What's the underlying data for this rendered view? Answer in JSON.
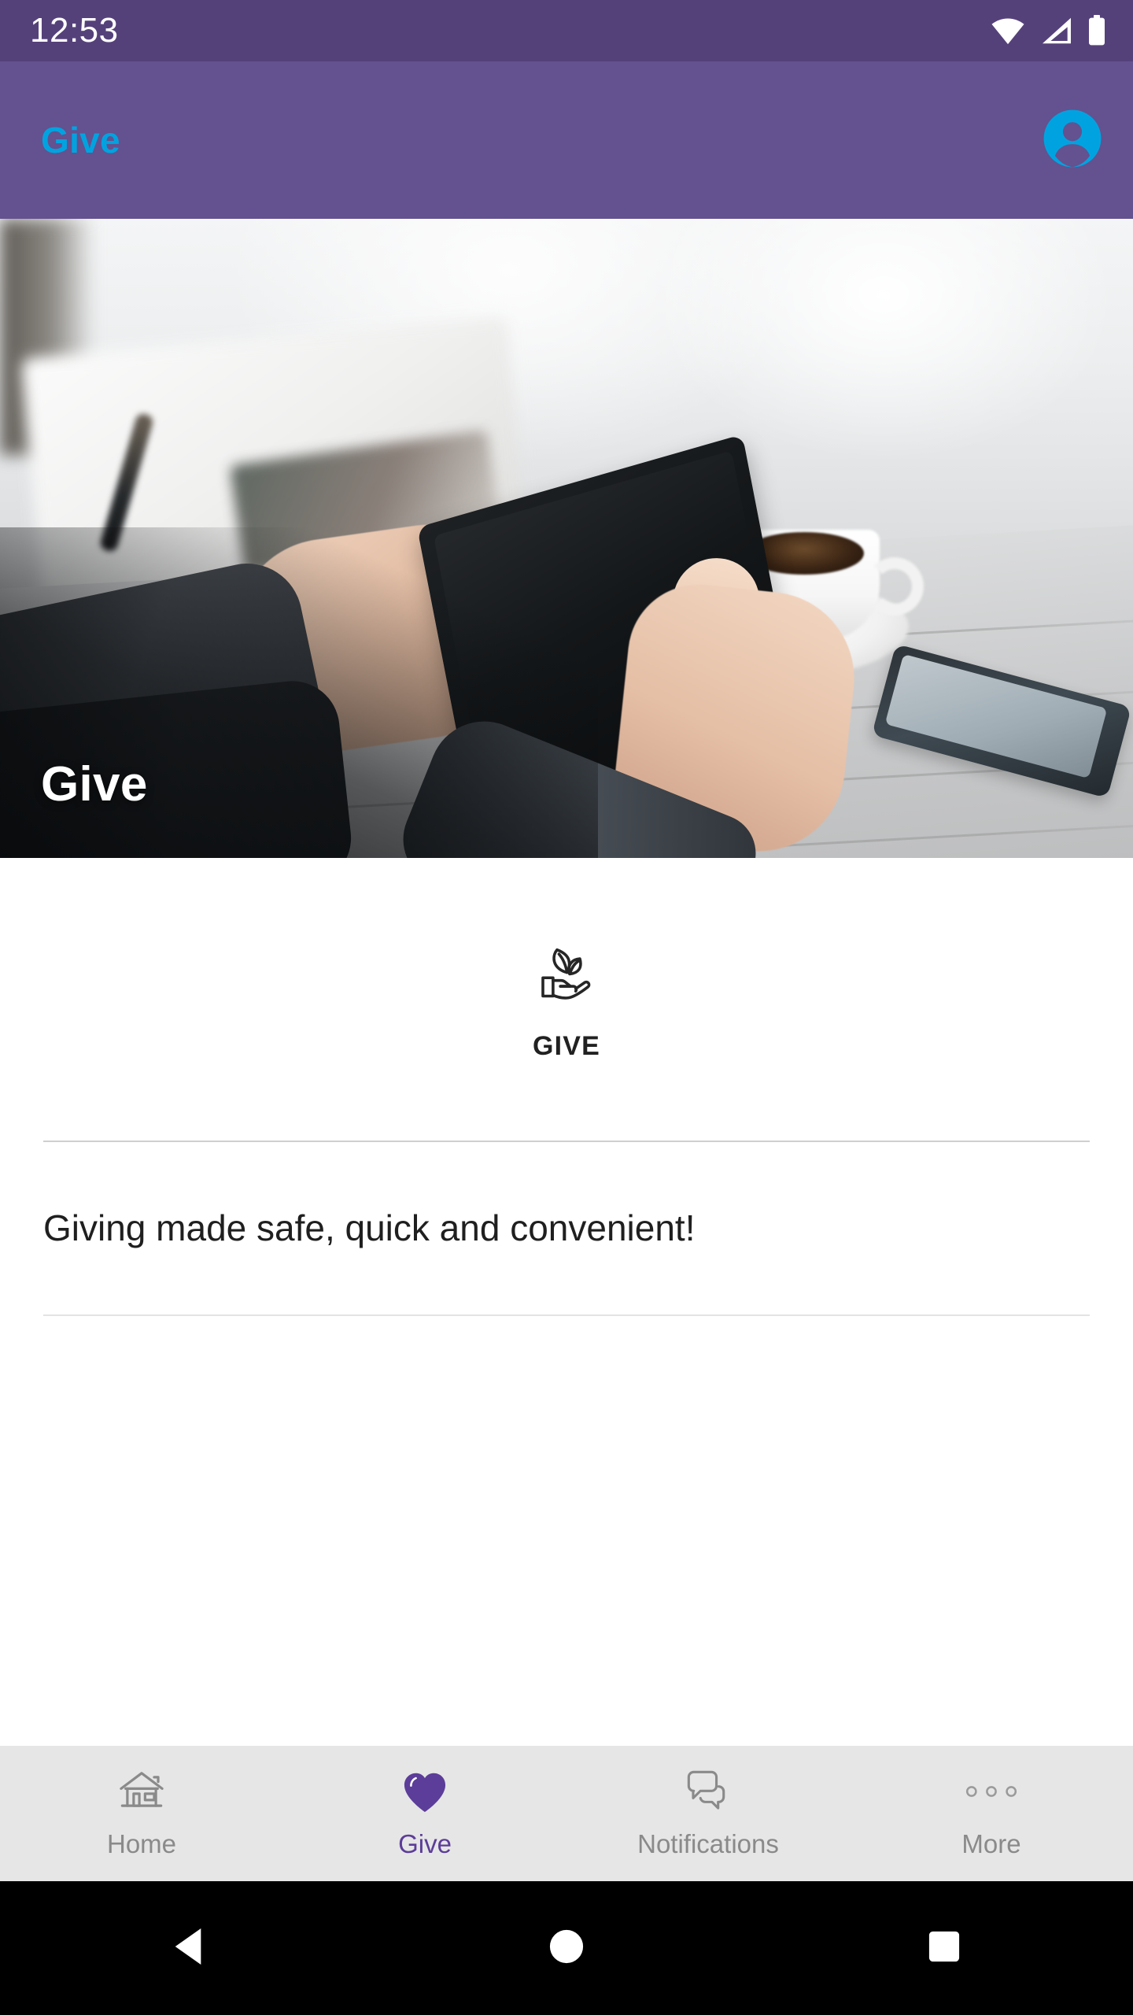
{
  "status_bar": {
    "time": "12:53",
    "icons": [
      "wifi-icon",
      "cellular-signal-icon",
      "battery-icon"
    ],
    "background_color": "#55417a",
    "foreground_color": "#ffffff"
  },
  "app_bar": {
    "title": "Give",
    "title_color": "#00a3e0",
    "background_color": "#64518f",
    "account_icon": "account-avatar-icon"
  },
  "hero": {
    "title": "Give",
    "image_description": "Person holding a black tablet at a light wooden table with a white cup of coffee and a smartphone"
  },
  "content": {
    "tile": {
      "icon": "hand-holding-plant-icon",
      "label": "GIVE"
    },
    "tagline": "Giving made safe, quick and convenient!"
  },
  "bottom_nav": {
    "active_color": "#5c3d99",
    "inactive_color": "#8a8a8a",
    "background_color": "#e6e6e6",
    "items": [
      {
        "label": "Home",
        "icon": "house-icon",
        "active": false
      },
      {
        "label": "Give",
        "icon": "heart-icon",
        "active": true
      },
      {
        "label": "Notifications",
        "icon": "speech-bubbles-icon",
        "active": false
      },
      {
        "label": "More",
        "icon": "three-dots-icon",
        "active": false
      }
    ]
  },
  "system_bar": {
    "buttons": [
      {
        "name": "back-button",
        "icon": "triangle-left-icon"
      },
      {
        "name": "home-button",
        "icon": "circle-icon"
      },
      {
        "name": "recents-button",
        "icon": "square-icon"
      }
    ]
  }
}
